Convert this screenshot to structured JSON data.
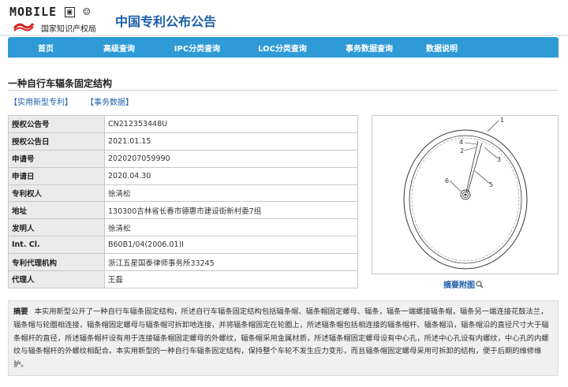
{
  "header": {
    "mobile_logo": "MOBILE",
    "agency": "国家知识产权局",
    "site_title": "中国专利公布公告"
  },
  "nav": {
    "items": [
      "首页",
      "高级查询",
      "IPC分类查询",
      "LOC分类查询",
      "事务数据查询",
      "数据说明"
    ]
  },
  "page": {
    "title": "一种自行车辐条固定结构",
    "tabs": [
      "【实用新型专利】",
      "【事务数据】"
    ]
  },
  "info": {
    "rows": [
      {
        "key": "授权公告号",
        "value": "CN212353448U"
      },
      {
        "key": "授权公告日",
        "value": "2021.01.15"
      },
      {
        "key": "申请号",
        "value": "2020207059990"
      },
      {
        "key": "申请日",
        "value": "2020.04.30"
      },
      {
        "key": "专利权人",
        "value": "徐清松"
      },
      {
        "key": "地址",
        "value": "130300吉林省长春市德惠市建设街新村委7组"
      },
      {
        "key": "发明人",
        "value": "徐清松"
      },
      {
        "key": "Int. Cl.",
        "value": "B60B1/04(2006.01)I"
      },
      {
        "key": "专利代理机构",
        "value": "浙江五星国泰律师事务所33245"
      },
      {
        "key": "代理人",
        "value": "王磊"
      }
    ]
  },
  "figure": {
    "caption": "摘要附图",
    "caption_icon": "magnifier-icon",
    "labels": [
      "1",
      "2",
      "3",
      "4",
      "5",
      "6"
    ]
  },
  "abstract": {
    "label": "摘要",
    "text": "本实用新型公开了一种自行车辐条固定结构，所述自行车辐条固定结构包括辐条帽、辐条帽固定螺母、辐条，辐条一端螺接辐条帽，辐条另一端连接花鼓法兰，辐条帽与轮圈相连接，辐条帽固定螺母与辐条帽可拆卸地连接，并将辐条帽固定在轮圈上，所述辐条帽包括相连接的辐条帽杆、辐条帽沿，辐条帽沿的直径尺寸大于辐条帽杆的直径，所述辐条帽杆设有用于连接辐条帽固定螺母的外螺纹，辐条帽采用金属材质，所述辐条帽固定螺母设有中心孔，所述中心孔设有内螺纹，中心孔的内螺纹与辐条帽杆的外螺纹相配合。本实用新型的一种自行车辐条固定结构，保持整个车轮不发生应力变形，而且辐条帽固定螺母采用可拆卸的结构，便于后期的维修维护。"
  }
}
